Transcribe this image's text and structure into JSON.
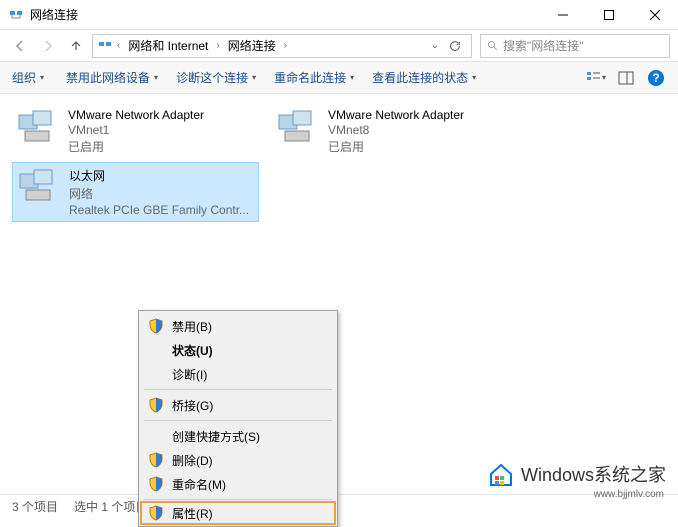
{
  "window": {
    "title": "网络连接"
  },
  "breadcrumb": {
    "root": "网络和 Internet",
    "current": "网络连接"
  },
  "search": {
    "placeholder": "搜索\"网络连接\""
  },
  "toolbar": {
    "organize": "组织",
    "disable": "禁用此网络设备",
    "diagnose": "诊断这个连接",
    "rename": "重命名此连接",
    "status": "查看此连接的状态"
  },
  "connections": [
    {
      "name": "VMware Network Adapter",
      "sub": "VMnet1",
      "status": "已启用"
    },
    {
      "name": "VMware Network Adapter",
      "sub": "VMnet8",
      "status": "已启用"
    },
    {
      "name": "以太网",
      "sub": "网络",
      "status": "Realtek PCIe GBE Family Contr..."
    }
  ],
  "context_menu": {
    "disable": "禁用(B)",
    "status": "状态(U)",
    "diagnose": "诊断(I)",
    "bridge": "桥接(G)",
    "shortcut": "创建快捷方式(S)",
    "delete": "删除(D)",
    "rename": "重命名(M)",
    "properties": "属性(R)"
  },
  "statusbar": {
    "count": "3 个项目",
    "selected": "选中 1 个项目"
  },
  "watermark": {
    "text": "Windows系统之家",
    "url": "www.bjjmlv.com"
  }
}
